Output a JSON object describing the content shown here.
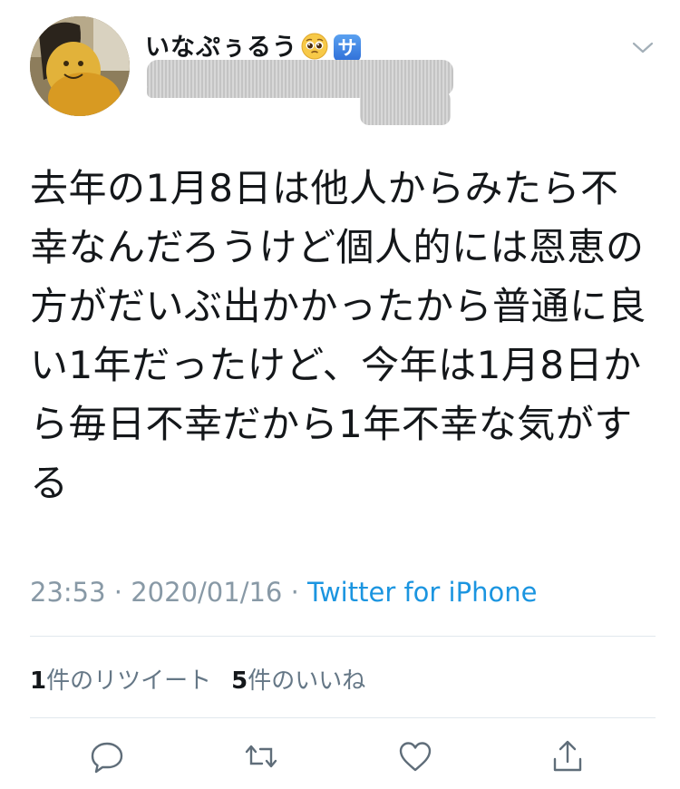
{
  "tweet": {
    "display_name": "いなぷぅるう",
    "name_emoji": "pleading-face-emoji",
    "name_badge": "サ",
    "handle": "",
    "text": "去年の1月8日は他人からみたら不幸なんだろうけど個人的には恩恵の方がだいぶ出かかったから普通に良い1年だったけど、今年は1月8日から毎日不幸だから1年不幸な気がする",
    "time": "23:53",
    "date": "2020/01/16",
    "source": "Twitter for iPhone",
    "sep": " · "
  },
  "stats": {
    "retweets_count": "1",
    "retweets_label": "件のリツイート",
    "likes_count": "5",
    "likes_label": "件のいいね"
  },
  "icons": {
    "menu": "chevron-down-icon",
    "reply": "reply-icon",
    "retweet": "retweet-icon",
    "like": "heart-icon",
    "share": "share-icon"
  },
  "colors": {
    "text": "#14171a",
    "secondary": "#8899a6",
    "link": "#1b95e0",
    "badge": "#3b7de0",
    "divider": "#e1e8ed"
  }
}
